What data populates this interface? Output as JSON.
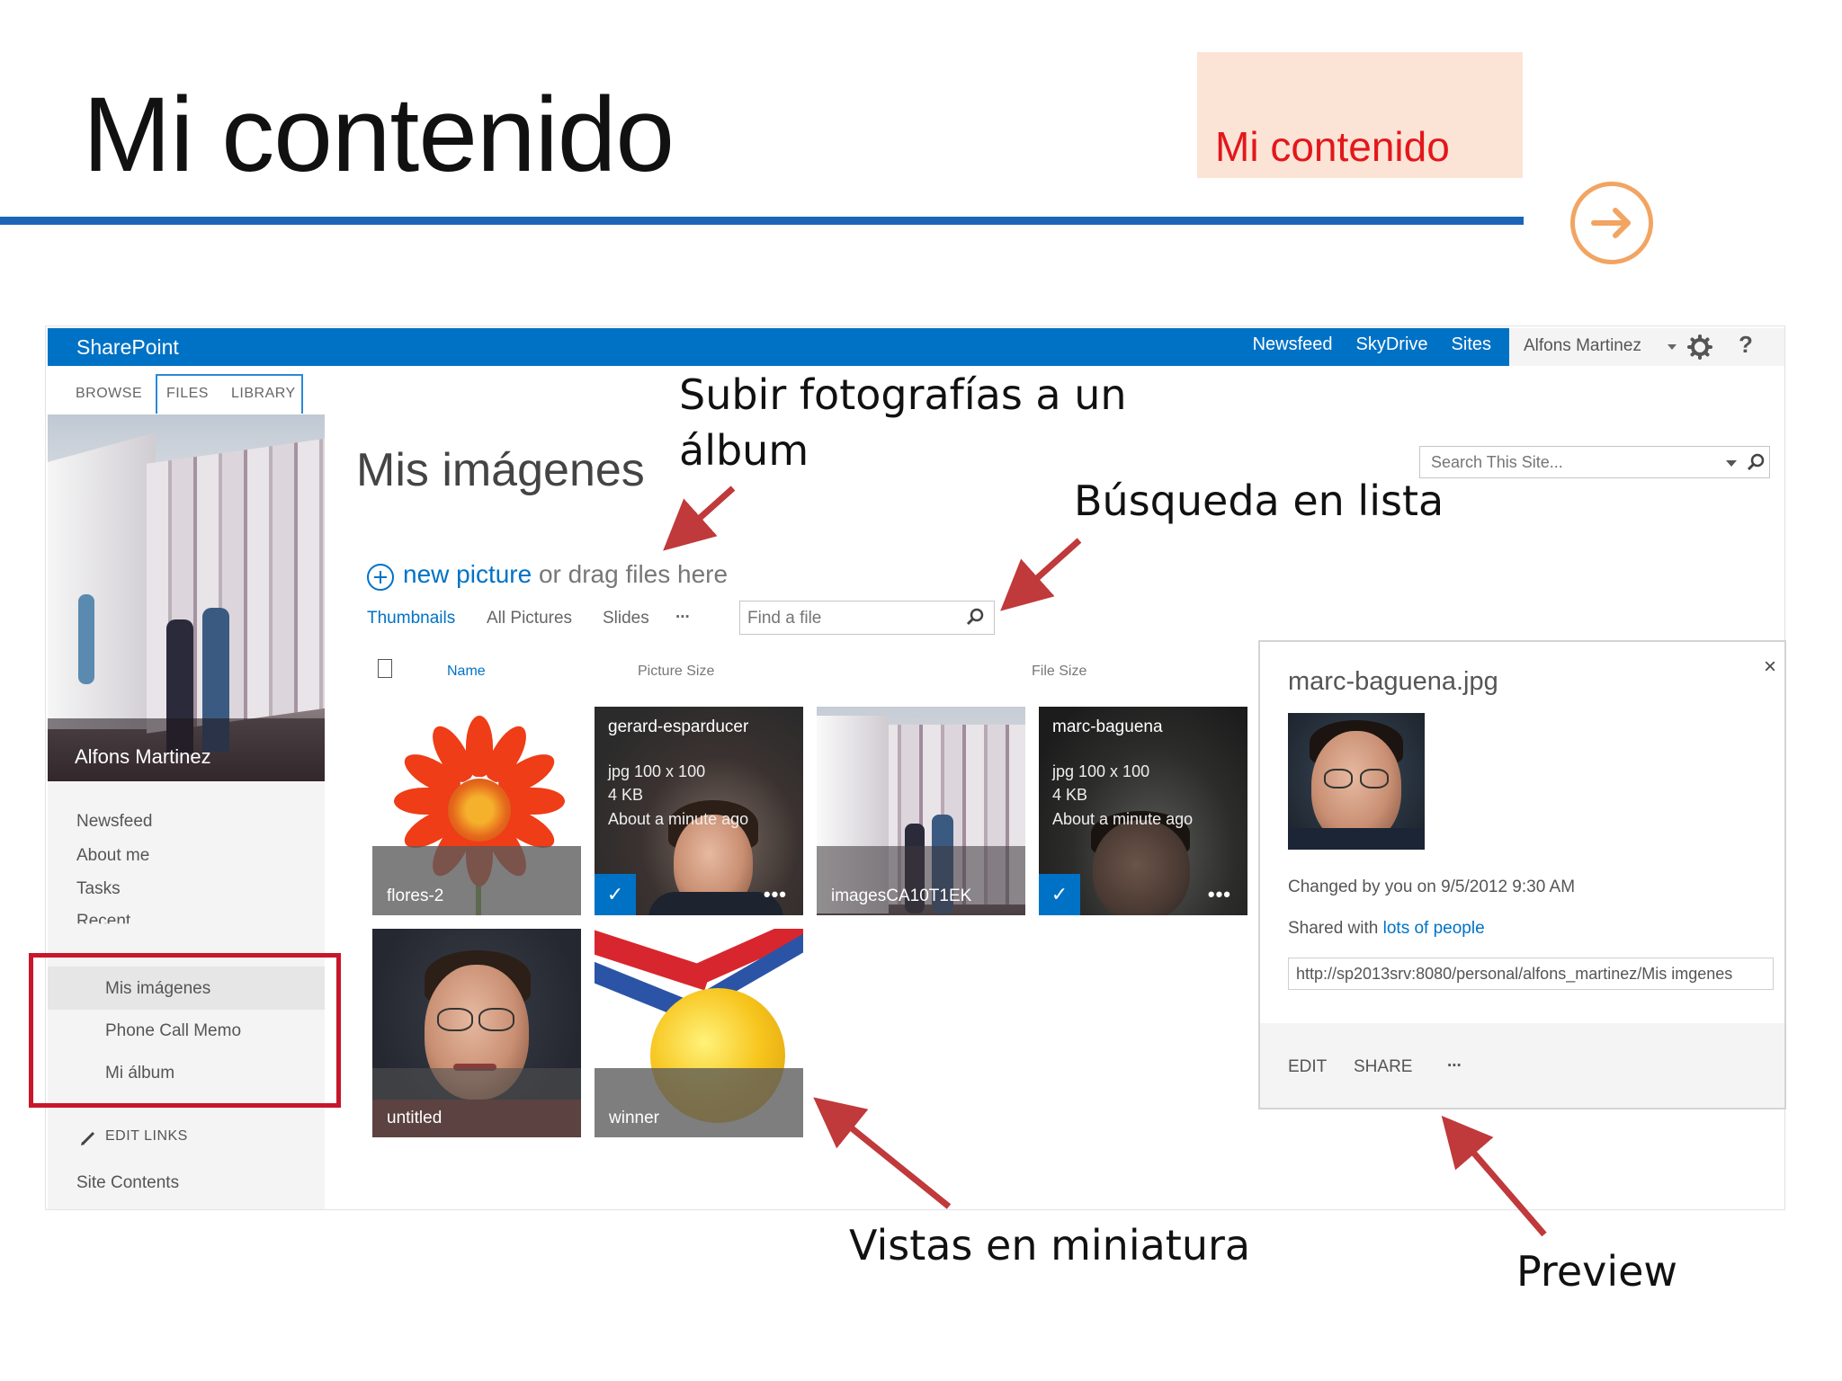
{
  "slide": {
    "title": "Mi contenido",
    "tag": "Mi contenido",
    "colors": {
      "rule": "#1a65b8",
      "tag_bg": "#fbe4d6",
      "tag_text": "#e3171b",
      "next_arrow": "#f2a462",
      "highlight": "#c8162a"
    },
    "next_icon": "arrow-right-circle-icon"
  },
  "suitebar": {
    "brand": "SharePoint",
    "links": [
      "Newsfeed",
      "SkyDrive",
      "Sites"
    ],
    "user": "Alfons Martinez",
    "settings_icon": "gear-icon",
    "help": "?",
    "color": "#0072c6"
  },
  "ribbon": {
    "tabs": [
      "BROWSE",
      "FILES",
      "LIBRARY"
    ]
  },
  "leftnav": {
    "profile_name": "Alfons Martinez",
    "items": [
      "Newsfeed",
      "About me",
      "Tasks"
    ],
    "recent_label": "Recent",
    "recent": [
      "Mis imágenes",
      "Phone Call Memo",
      "Mi álbum"
    ],
    "edit_links": "EDIT LINKS",
    "site_contents": "Site Contents"
  },
  "library": {
    "title": "Mis imágenes",
    "new_link": "new picture",
    "new_rest": " or drag files here",
    "views": [
      "Thumbnails",
      "All Pictures",
      "Slides",
      "..."
    ],
    "find_placeholder": "Find a file",
    "columns": [
      "Name",
      "Picture Size",
      "File Size"
    ],
    "search_placeholder": "Search This Site..."
  },
  "tiles": [
    {
      "name": "flores-2"
    },
    {
      "name": "gerard-esparducer",
      "size": "jpg 100 x 100",
      "kb": "4 KB",
      "when": "About a minute ago",
      "selected": true
    },
    {
      "name": "imagesCA10T1EK"
    },
    {
      "name": "marc-baguena",
      "size": "jpg 100 x 100",
      "kb": "4 KB",
      "when": "About a minute ago",
      "selected": true
    },
    {
      "name": "untitled"
    },
    {
      "name": "winner"
    }
  ],
  "preview": {
    "title": "marc-baguena.jpg",
    "changed": "Changed by you on 9/5/2012 9:30 AM",
    "shared_prefix": "Shared with ",
    "shared_link": "lots of people",
    "url": "http://sp2013srv:8080/personal/alfons_martinez/Mis imgenes",
    "actions": [
      "EDIT",
      "SHARE",
      "..."
    ],
    "close": "×"
  },
  "annotations": {
    "upload": "Subir fotografías a un",
    "upload2": "álbum",
    "search": "Búsqueda en lista",
    "thumbs": "Vistas en miniatura",
    "preview": "Preview"
  }
}
